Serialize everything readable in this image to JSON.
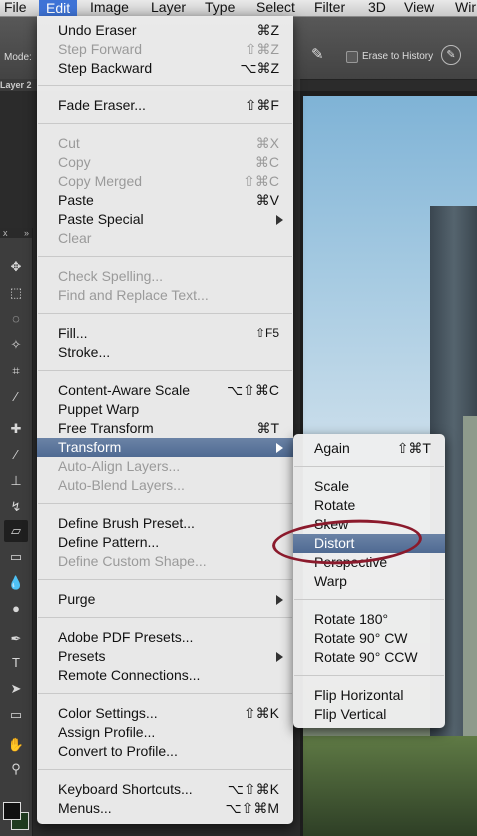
{
  "menubar": {
    "items": [
      "File",
      "Edit",
      "Image",
      "Layer",
      "Type",
      "Select",
      "Filter",
      "3D",
      "View",
      "Wir"
    ],
    "active": "Edit"
  },
  "options_bar": {
    "mode_label": "Mode:",
    "erase_history_label": "Erase to History"
  },
  "layer_tab": "Layer 2",
  "toolbar": {
    "close_glyph": "x",
    "collapse_glyph": "»"
  },
  "edit_menu": {
    "items": [
      {
        "label": "Undo Eraser",
        "shortcut": "⌘Z",
        "disabled": false
      },
      {
        "label": "Step Forward",
        "shortcut": "⇧⌘Z",
        "disabled": true
      },
      {
        "label": "Step Backward",
        "shortcut": "⌥⌘Z",
        "disabled": false
      },
      {
        "label": "Fade Eraser...",
        "shortcut": "⇧⌘F",
        "disabled": false
      },
      {
        "label": "Cut",
        "shortcut": "⌘X",
        "disabled": true
      },
      {
        "label": "Copy",
        "shortcut": "⌘C",
        "disabled": true
      },
      {
        "label": "Copy Merged",
        "shortcut": "⇧⌘C",
        "disabled": true
      },
      {
        "label": "Paste",
        "shortcut": "⌘V",
        "disabled": false
      },
      {
        "label": "Paste Special",
        "shortcut": "",
        "submenu": true,
        "disabled": false
      },
      {
        "label": "Clear",
        "shortcut": "",
        "disabled": true
      },
      {
        "label": "Check Spelling...",
        "shortcut": "",
        "disabled": true
      },
      {
        "label": "Find and Replace Text...",
        "shortcut": "",
        "disabled": true
      },
      {
        "label": "Fill...",
        "shortcut": "⇧F5",
        "disabled": false
      },
      {
        "label": "Stroke...",
        "shortcut": "",
        "disabled": false
      },
      {
        "label": "Content-Aware Scale",
        "shortcut": "⌥⇧⌘C",
        "disabled": false
      },
      {
        "label": "Puppet Warp",
        "shortcut": "",
        "disabled": false
      },
      {
        "label": "Free Transform",
        "shortcut": "⌘T",
        "disabled": false
      },
      {
        "label": "Transform",
        "shortcut": "",
        "submenu": true,
        "highlighted": true,
        "disabled": false
      },
      {
        "label": "Auto-Align Layers...",
        "shortcut": "",
        "disabled": true
      },
      {
        "label": "Auto-Blend Layers...",
        "shortcut": "",
        "disabled": true
      },
      {
        "label": "Define Brush Preset...",
        "shortcut": "",
        "disabled": false
      },
      {
        "label": "Define Pattern...",
        "shortcut": "",
        "disabled": false
      },
      {
        "label": "Define Custom Shape...",
        "shortcut": "",
        "disabled": true
      },
      {
        "label": "Purge",
        "shortcut": "",
        "submenu": true,
        "disabled": false
      },
      {
        "label": "Adobe PDF Presets...",
        "shortcut": "",
        "disabled": false
      },
      {
        "label": "Presets",
        "shortcut": "",
        "submenu": true,
        "disabled": false
      },
      {
        "label": "Remote Connections...",
        "shortcut": "",
        "disabled": false
      },
      {
        "label": "Color Settings...",
        "shortcut": "⇧⌘K",
        "disabled": false
      },
      {
        "label": "Assign Profile...",
        "shortcut": "",
        "disabled": false
      },
      {
        "label": "Convert to Profile...",
        "shortcut": "",
        "disabled": false
      },
      {
        "label": "Keyboard Shortcuts...",
        "shortcut": "⌥⇧⌘K",
        "disabled": false
      },
      {
        "label": "Menus...",
        "shortcut": "⌥⇧⌘M",
        "disabled": false
      }
    ]
  },
  "transform_menu": {
    "items": [
      {
        "label": "Again",
        "shortcut": "⇧⌘T"
      },
      {
        "label": "Scale",
        "shortcut": ""
      },
      {
        "label": "Rotate",
        "shortcut": ""
      },
      {
        "label": "Skew",
        "shortcut": ""
      },
      {
        "label": "Distort",
        "shortcut": "",
        "highlighted": true
      },
      {
        "label": "Perspective",
        "shortcut": ""
      },
      {
        "label": "Warp",
        "shortcut": ""
      },
      {
        "label": "Rotate 180°",
        "shortcut": ""
      },
      {
        "label": "Rotate 90° CW",
        "shortcut": ""
      },
      {
        "label": "Rotate 90° CCW",
        "shortcut": ""
      },
      {
        "label": "Flip Horizontal",
        "shortcut": ""
      },
      {
        "label": "Flip Vertical",
        "shortcut": ""
      }
    ]
  },
  "colors": {
    "menu_highlight": "#5a739c",
    "menubar_active": "#3e73d6",
    "annotation_ring": "#8b1a2c"
  }
}
